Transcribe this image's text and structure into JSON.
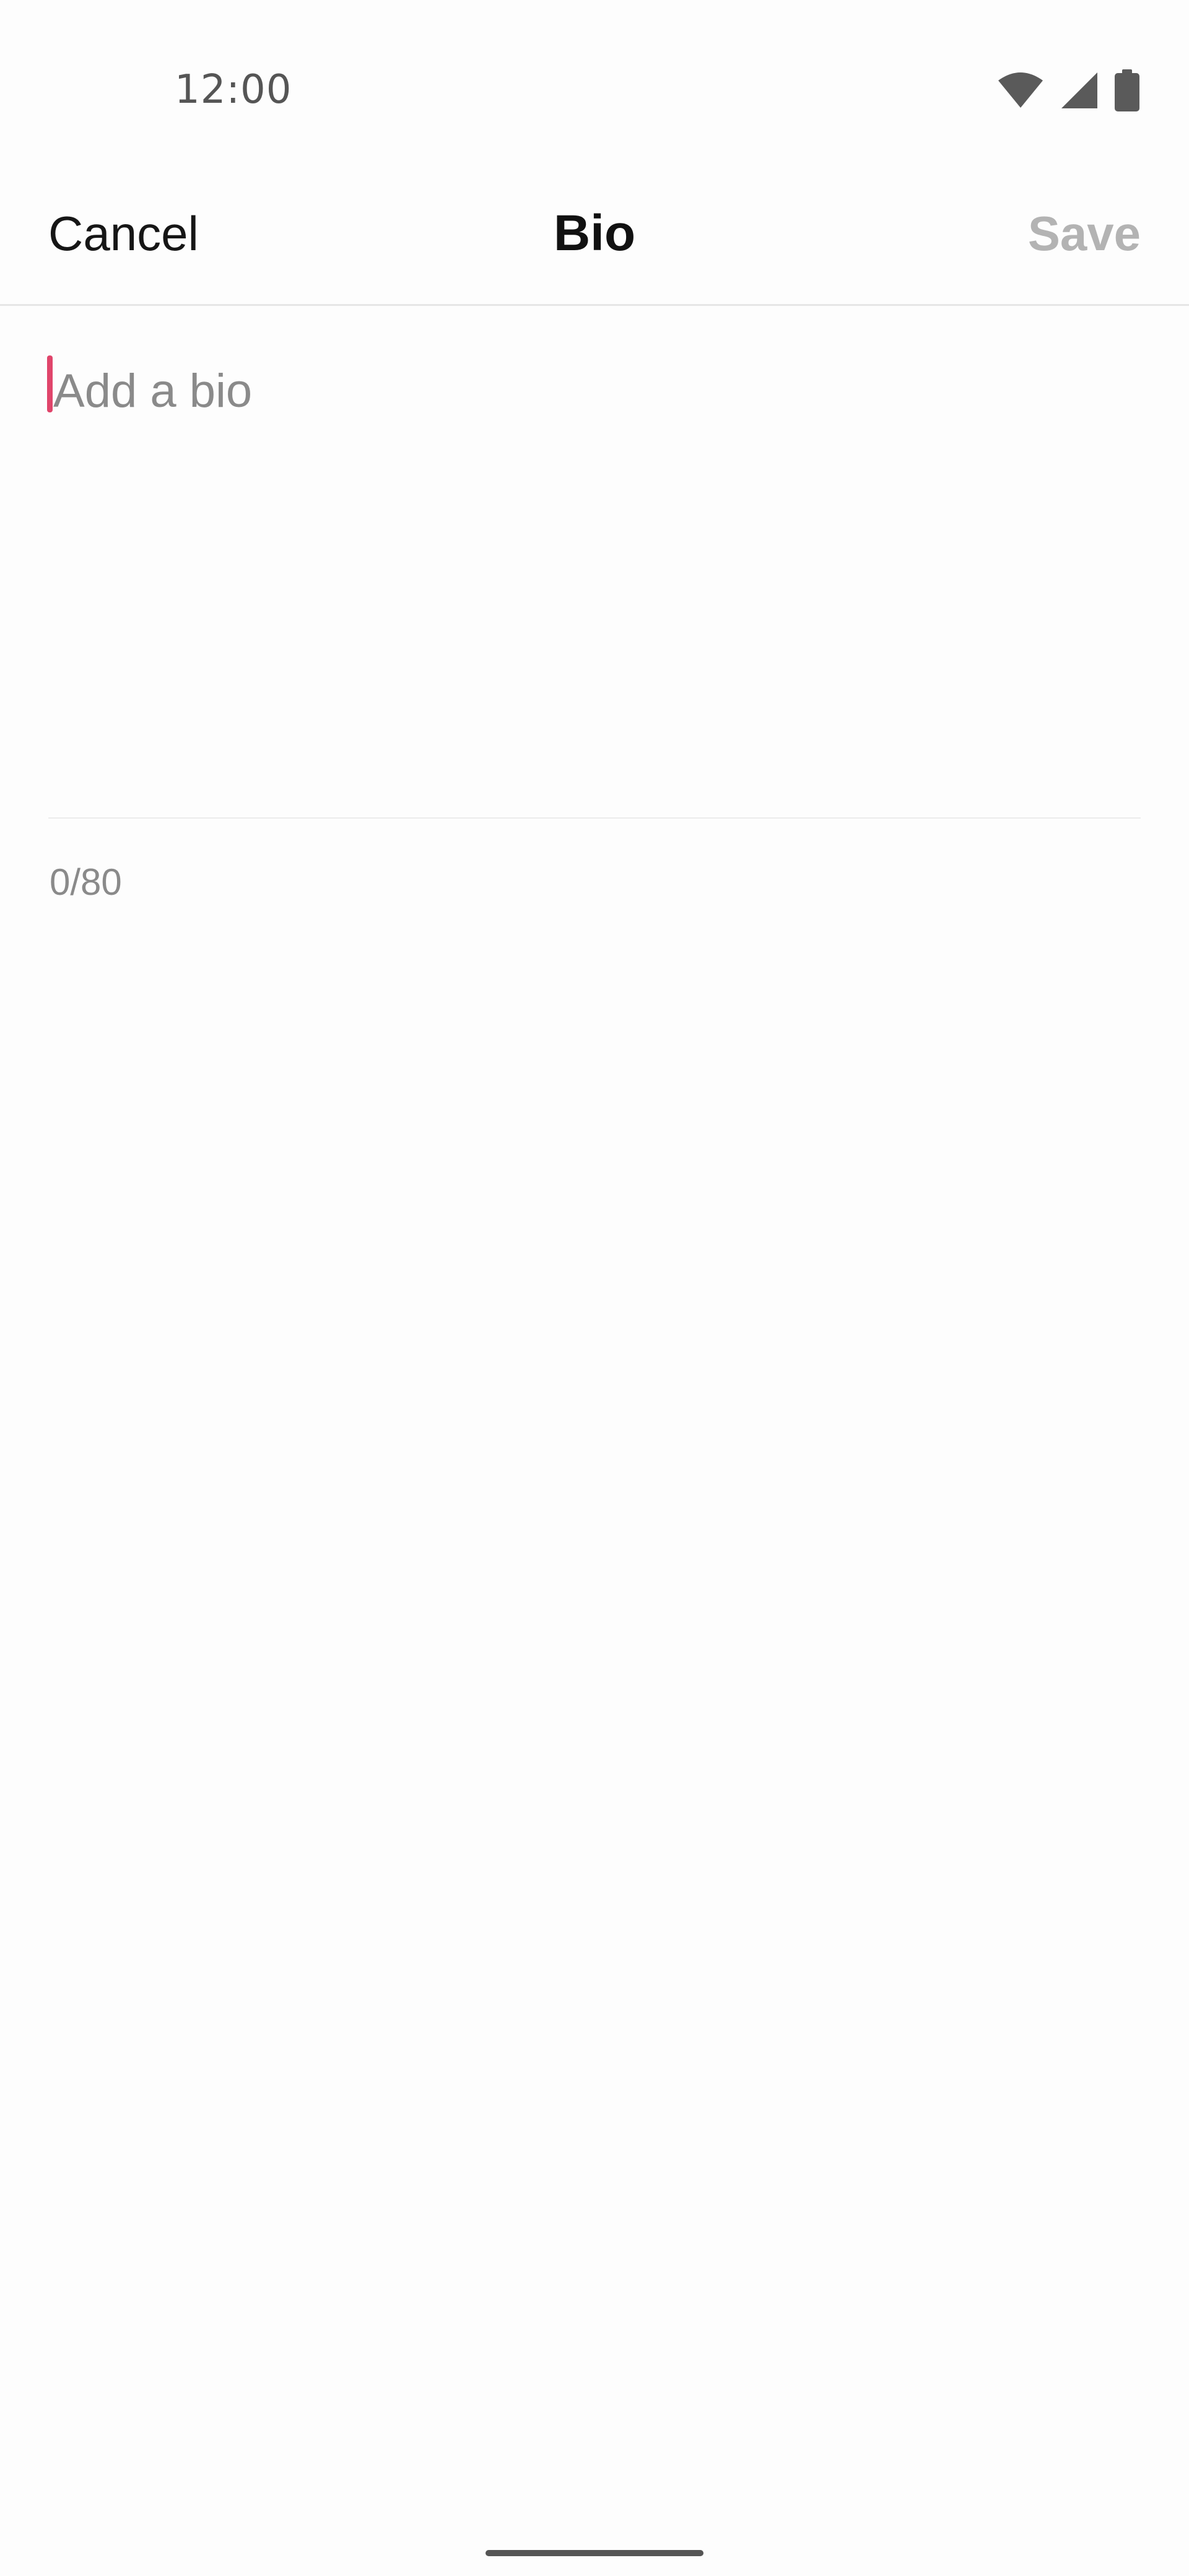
{
  "status_bar": {
    "time": "12:00",
    "icons": [
      "wifi-icon",
      "cellular-signal-icon",
      "battery-icon"
    ],
    "icon_color": "#5a5a5a"
  },
  "header": {
    "cancel_label": "Cancel",
    "title": "Bio",
    "save_label": "Save",
    "save_color": "#b3b3b3"
  },
  "bio_input": {
    "placeholder": "Add a bio",
    "value": "",
    "caret_color": "#e0456b"
  },
  "counter": {
    "text": "0/80"
  }
}
